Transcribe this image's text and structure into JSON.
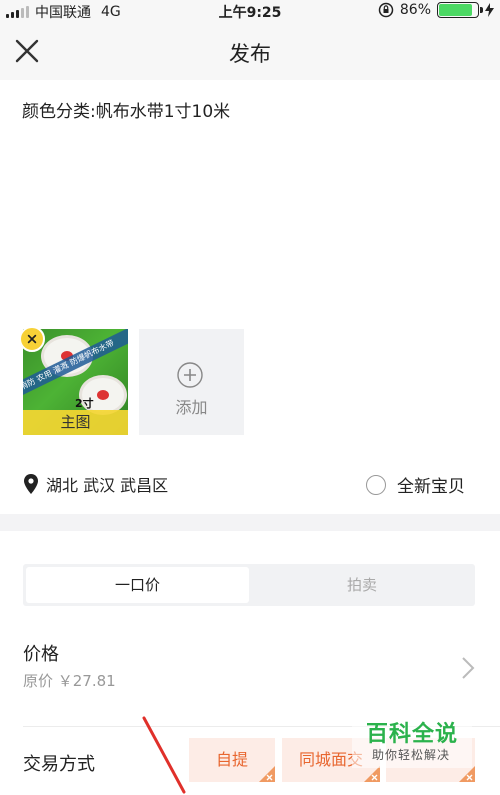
{
  "status_bar": {
    "carrier": "中国联通",
    "network": "4G",
    "time": "上午9:25",
    "battery_percent": "86%",
    "battery_level": 0.86,
    "battery_color": "#4cd964"
  },
  "nav": {
    "title": "发布",
    "close_icon": "close-icon"
  },
  "description": "颜色分类:帆布水带1寸10米",
  "photos": {
    "main": {
      "label": "主图",
      "banner_text": "消防 农用 灌溉 防爆帆布水带",
      "size_text": "2寸",
      "remove_icon": "remove-x-icon"
    },
    "add": {
      "label": "添加",
      "icon": "plus-circle-icon"
    }
  },
  "location": {
    "icon": "location-pin-icon",
    "text": "湖北 武汉 武昌区"
  },
  "new_item": {
    "label": "全新宝贝",
    "checked": false
  },
  "price_mode": {
    "options": [
      "一口价",
      "拍卖"
    ],
    "selected": "一口价"
  },
  "price": {
    "label": "价格",
    "original": "原价 ￥27.81",
    "chevron_icon": "chevron-right-icon"
  },
  "trade": {
    "label": "交易方式",
    "options": [
      "自提",
      "同城面交",
      ""
    ]
  },
  "watermark": {
    "title": "百科全说",
    "subtitle": "助你轻松解决"
  },
  "colors": {
    "accent_yellow": "#f7d137",
    "trade_orange": "#e8662f",
    "trade_bg": "#fdece6",
    "watermark_green": "#2bb24c"
  }
}
